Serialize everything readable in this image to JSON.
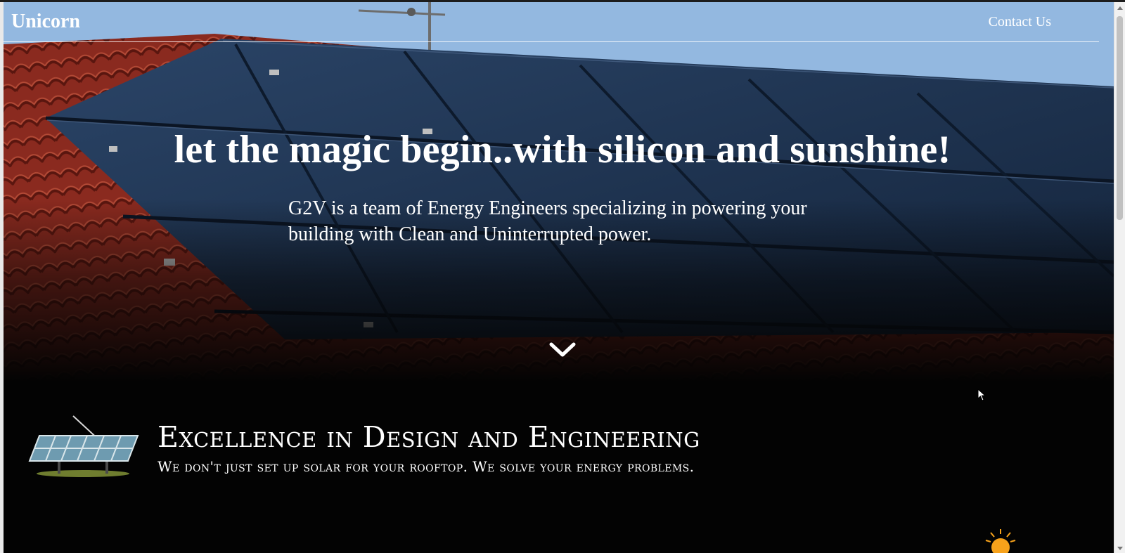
{
  "navbar": {
    "brand": "Unicorn",
    "contact_label": "Contact Us"
  },
  "hero": {
    "title": "let the magic begin..with silicon and sunshine!",
    "description": "G2V is a team of Energy Engineers specializing in powering your building with Clean and Uninterrupted power.",
    "scroll_icon": "chevron-down-icon"
  },
  "feature": {
    "icon": "solar-panel-icon",
    "title": "Excellence in Design and Engineering",
    "subtitle": "We don't just set up solar for your rooftop. We solve your energy problems."
  },
  "decorations": {
    "sun_icon": "sun-icon",
    "cursor_icon": "mouse-pointer-icon"
  },
  "colors": {
    "page_background": "#030303",
    "text": "#ffffff",
    "roof_tile": "#8e2b20",
    "panel": "#1c2f4a",
    "sun": "#f7a21b"
  }
}
